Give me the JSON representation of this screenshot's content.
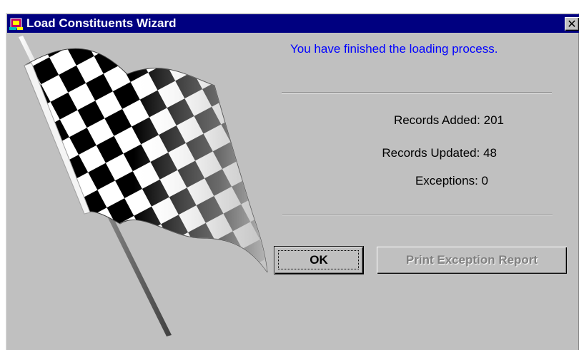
{
  "window": {
    "title": "Load Constituents Wizard",
    "close_label": "✕"
  },
  "main": {
    "message": "You have finished the loading process.",
    "stats": {
      "added": "Records Added: 201",
      "updated": "Records Updated: 48",
      "exceptions": "Exceptions: 0"
    }
  },
  "buttons": {
    "ok": "OK",
    "print_report": "Print Exception Report"
  },
  "icons": {
    "app": "wizard-app-icon",
    "illustration": "checkered-flag-icon",
    "close": "close-icon"
  },
  "colors": {
    "titlebar": "#000080",
    "window": "#c0c0c0",
    "message_text": "#0000ff",
    "disabled_text": "#808080"
  }
}
